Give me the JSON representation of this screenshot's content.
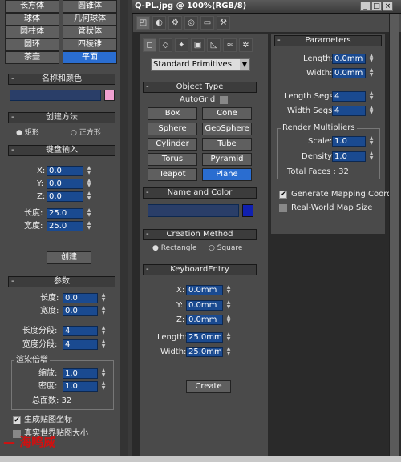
{
  "left": {
    "objects": [
      "长方体",
      "圆锥体",
      "球体",
      "几何球体",
      "圆柱体",
      "管状体",
      "圆环",
      "四棱锥",
      "茶壶",
      "平面"
    ],
    "name_color_header": "名称和颜色",
    "creation_header": "创建方法",
    "creation_options": [
      "矩形",
      "正方形"
    ],
    "keyboard_header": "键盘输入",
    "kb_labels": [
      "X:",
      "Y:",
      "Z:",
      "长度:",
      "宽度:"
    ],
    "kb_values": [
      "0.0",
      "0.0",
      "0.0",
      "25.0",
      "25.0"
    ],
    "create_label": "创建",
    "params_header": "参数",
    "param_labels": [
      "长度:",
      "宽度:",
      "长度分段:",
      "宽度分段:"
    ],
    "param_values": [
      "0.0",
      "0.0",
      "4",
      "4"
    ],
    "render_mult": "渲染倍增",
    "scale_label": "缩放:",
    "scale_value": "1.0",
    "density_label": "密度:",
    "density_value": "1.0",
    "total_faces": "总面数: 32",
    "gen_map": "生成贴图坐标",
    "real_world": "真实世界贴图大小",
    "watermark": "海鸣威"
  },
  "right": {
    "title": "Q-PL.jpg @ 100%(RGB/8)",
    "dropdown": "Standard Primitives",
    "object_type_header": "Object Type",
    "autogrid": "AutoGrid",
    "objects": [
      "Box",
      "Cone",
      "Sphere",
      "GeoSphere",
      "Cylinder",
      "Tube",
      "Torus",
      "Pyramid",
      "Teapot",
      "Plane"
    ],
    "name_color_header": "Name and Color",
    "creation_header": "Creation Method",
    "creation_options": [
      "Rectangle",
      "Square"
    ],
    "keyboard_header": "KeyboardEntry",
    "kb_labels": [
      "X:",
      "Y:",
      "Z:",
      "Length:",
      "Width:"
    ],
    "kb_values": [
      "0.0mm",
      "0.0mm",
      "0.0mm",
      "25.0mm",
      "25.0mm"
    ],
    "create_label": "Create",
    "params_header": "Parameters",
    "param_labels": [
      "Length:",
      "Width:",
      "Length Segs:",
      "Width Segs:"
    ],
    "param_values": [
      "0.0mm",
      "0.0mm",
      "4",
      "4"
    ],
    "render_mult": "Render Multipliers",
    "scale_label": "Scale:",
    "scale_value": "1.0",
    "density_label": "Density:",
    "density_value": "1.0",
    "total_faces": "Total Faces : 32",
    "gen_map": "Generate Mapping Coords.",
    "real_world": "Real-World Map Size"
  }
}
